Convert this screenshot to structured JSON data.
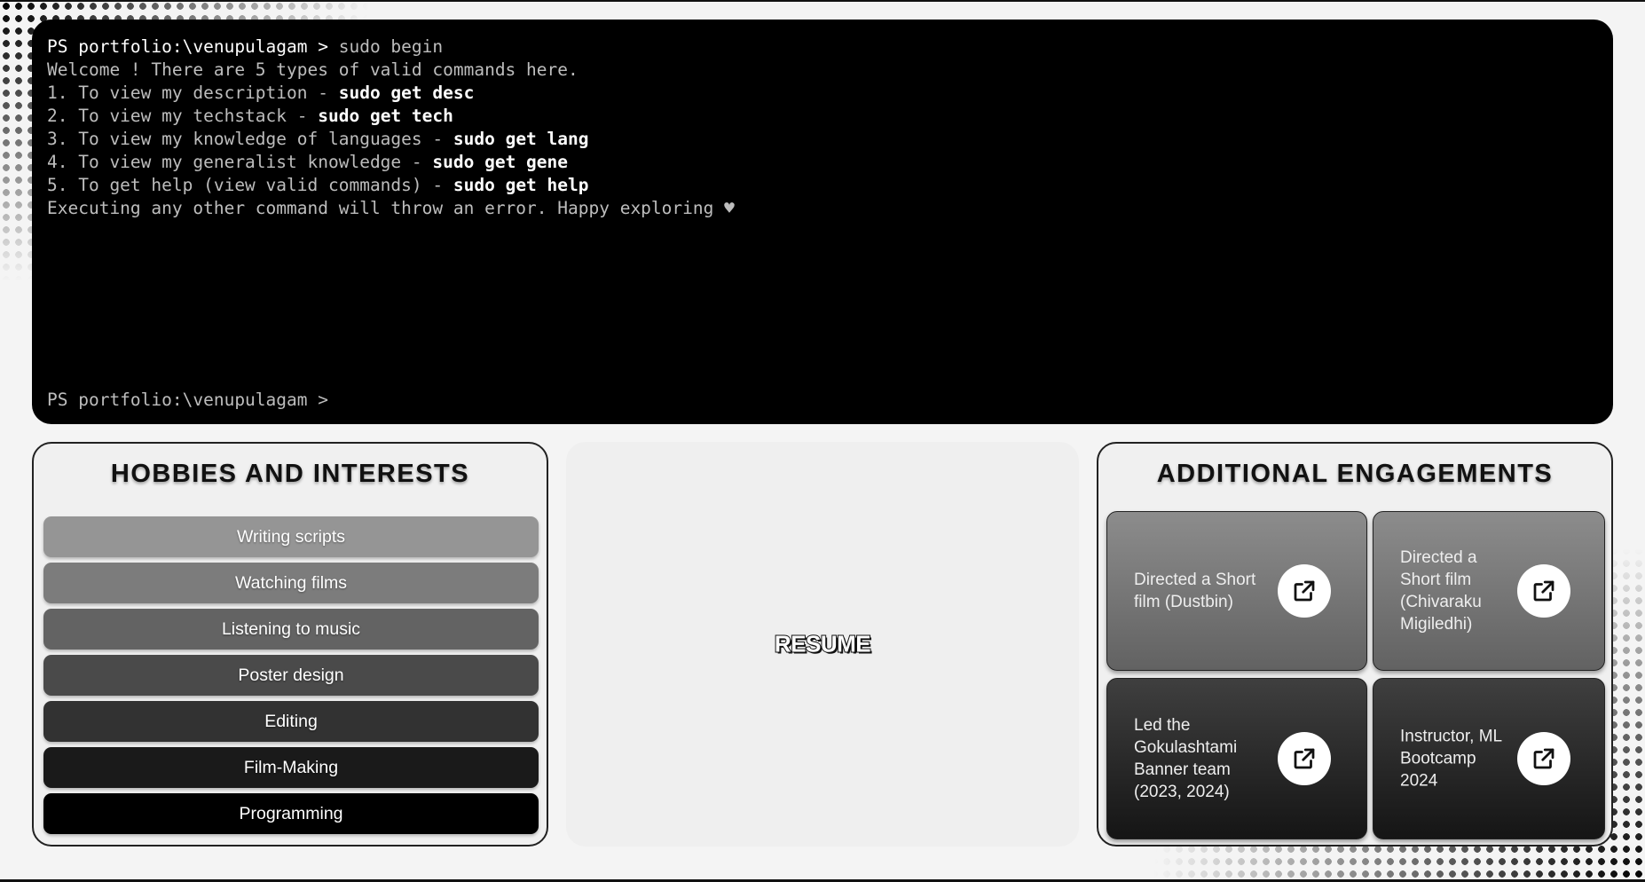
{
  "terminal": {
    "lines": [
      {
        "prompt": "PS portfolio:\\venupulagam > ",
        "typed": "sudo begin"
      },
      {
        "text": "Welcome ! There are 5 types of valid commands here."
      },
      {
        "text": "1. To view my description - ",
        "cmd": "sudo get desc"
      },
      {
        "text": "2. To view my techstack - ",
        "cmd": "sudo get tech"
      },
      {
        "text": "3. To view my knowledge of languages - ",
        "cmd": "sudo get lang"
      },
      {
        "text": "4. To view my generalist knowledge - ",
        "cmd": "sudo get gene"
      },
      {
        "text": "5. To get help (view valid commands) - ",
        "cmd": "sudo get help"
      },
      {
        "text": "Executing any other command will throw an error. Happy exploring ",
        "icon": "♥"
      }
    ],
    "prompt": "PS portfolio:\\venupulagam >"
  },
  "hobbies": {
    "title": "HOBBIES AND INTERESTS",
    "items": [
      {
        "label": "Writing scripts",
        "color": "#959595"
      },
      {
        "label": "Watching films",
        "color": "#7c7c7c"
      },
      {
        "label": "Listening to music",
        "color": "#636363"
      },
      {
        "label": "Poster design",
        "color": "#4a4a4a"
      },
      {
        "label": "Editing",
        "color": "#323232"
      },
      {
        "label": "Film-Making",
        "color": "#1a1a1a"
      },
      {
        "label": "Programming",
        "color": "#000000"
      }
    ]
  },
  "resume": {
    "label": "RESUME"
  },
  "engagements": {
    "title": "ADDITIONAL ENGAGEMENTS",
    "items": [
      {
        "label": "Directed a Short film (Dustbin)",
        "icon": "external-link-icon"
      },
      {
        "label": "Directed a Short film (Chivaraku Migiledhi)",
        "icon": "external-link-icon"
      },
      {
        "label": "Led the Gokulashtami Banner team (2023, 2024)",
        "icon": "external-link-icon"
      },
      {
        "label": "Instructor, ML Bootcamp 2024",
        "icon": "external-link-icon"
      }
    ]
  },
  "colors": {
    "background": "#f4f4f4",
    "terminal_bg": "#000000",
    "terminal_text": "#bdbdbd",
    "accent": "#111111"
  }
}
